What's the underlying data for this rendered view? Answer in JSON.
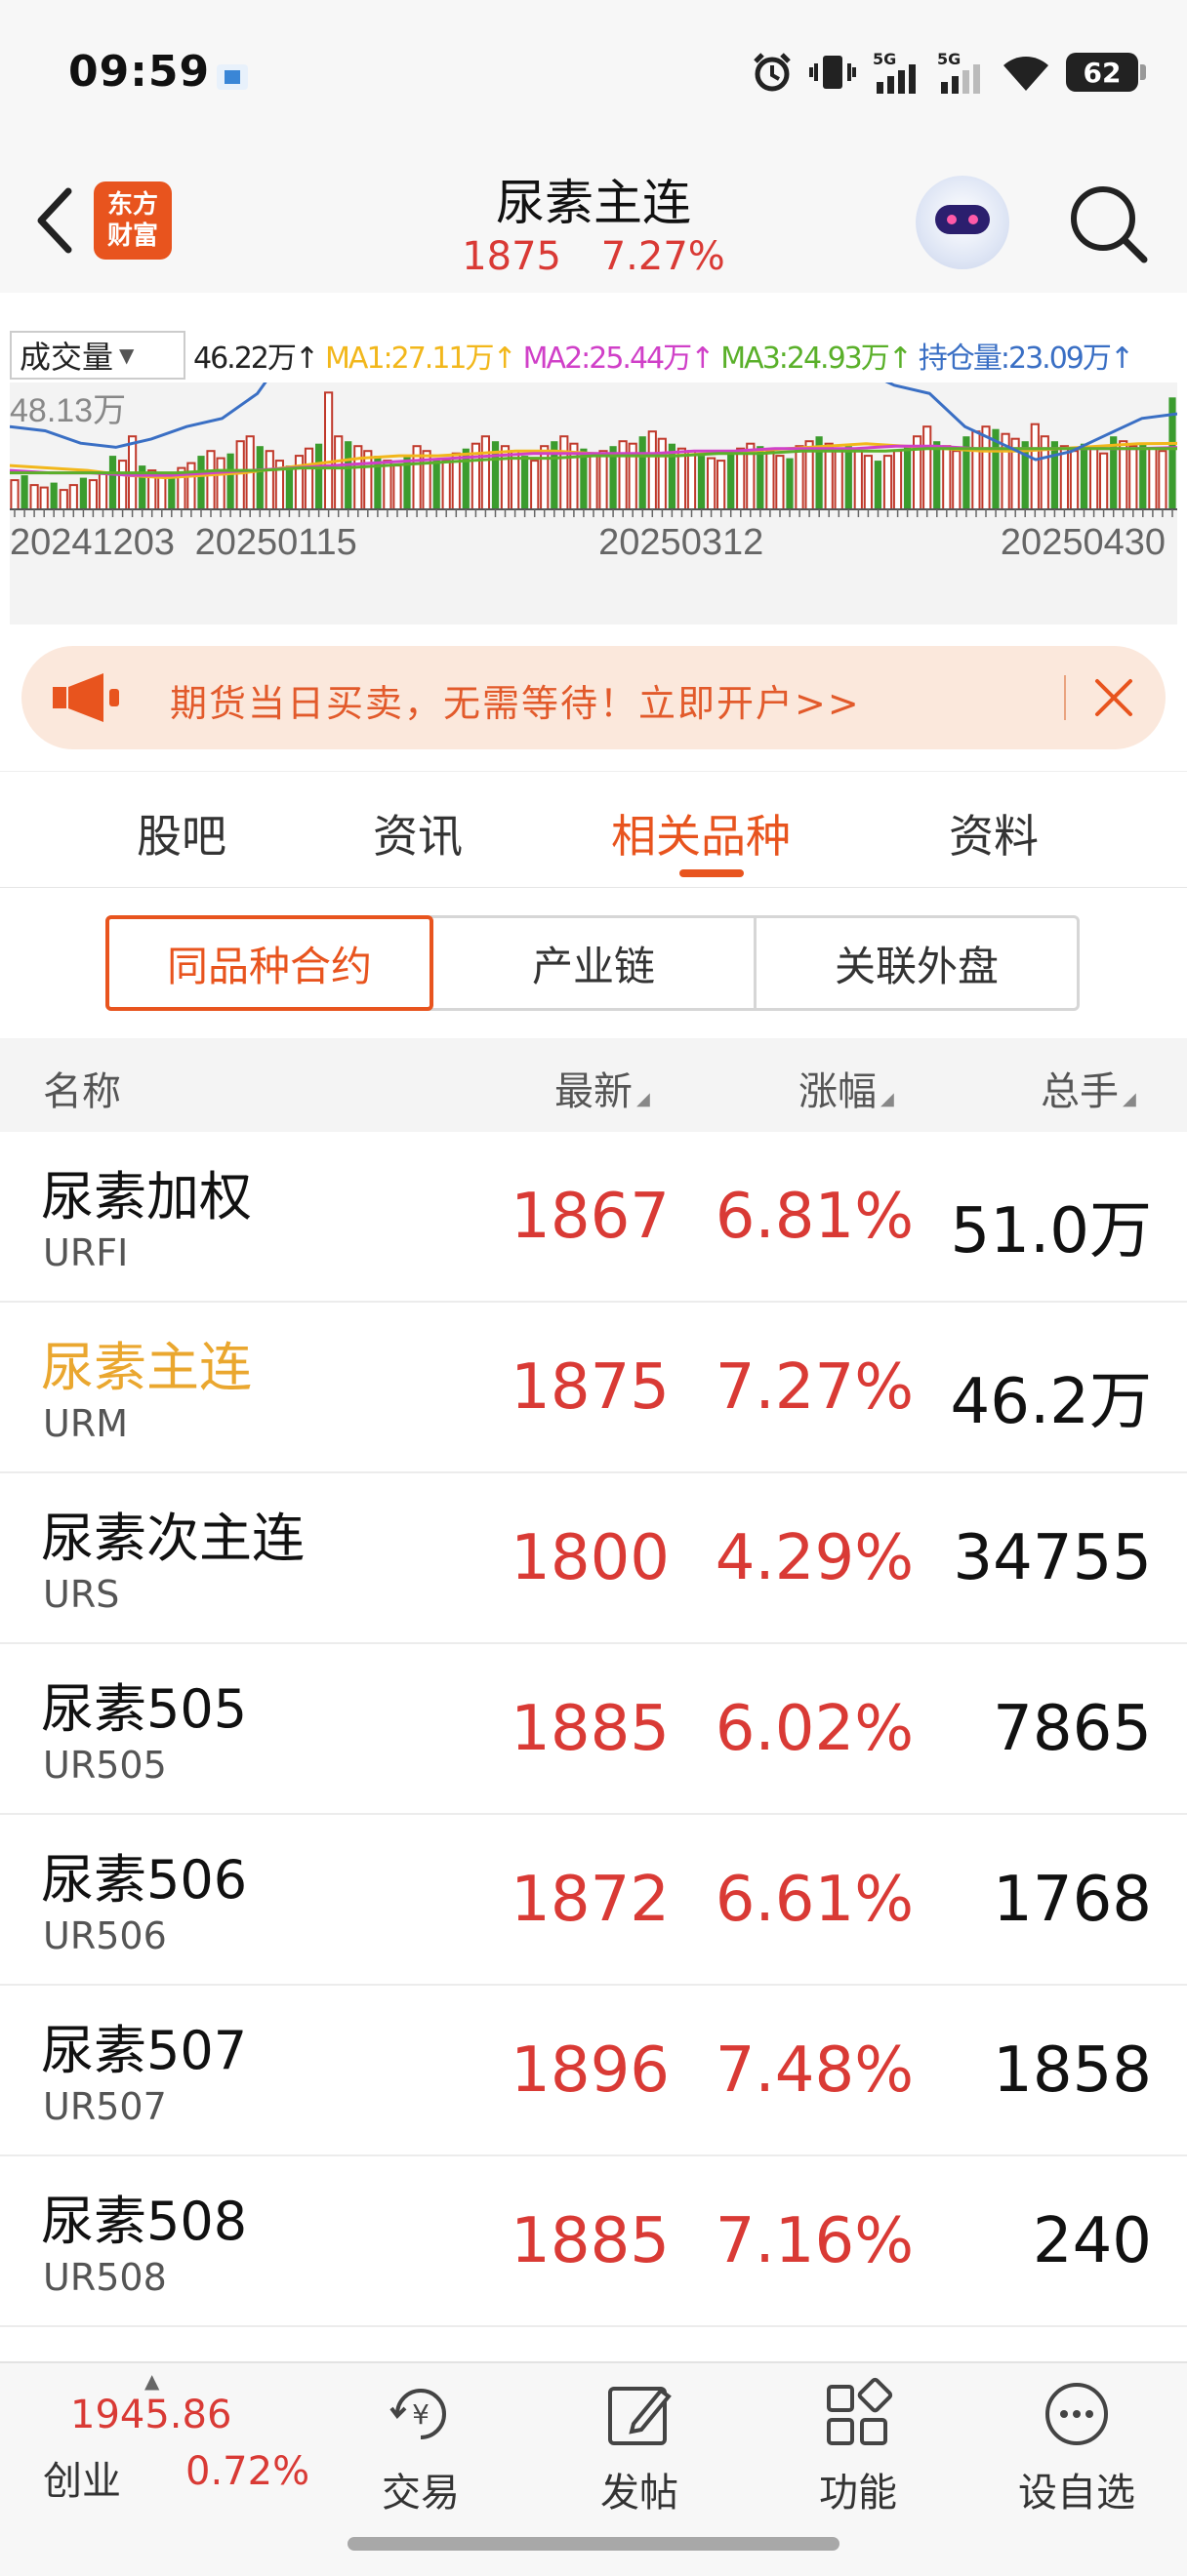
{
  "status": {
    "time": "09:59",
    "battery": "62",
    "net1": "5G",
    "net2": "5G"
  },
  "header": {
    "title": "尿素主连",
    "price": "1875",
    "change": "7.27%",
    "logo_line1": "东方",
    "logo_line2": "财富"
  },
  "chart": {
    "selector": "成交量",
    "volume_value": "46.22万↑",
    "ma1": "MA1:27.11万↑",
    "ma2": "MA2:25.44万↑",
    "ma3": "MA3:24.93万↑",
    "open_interest": "持仓量:23.09万↑",
    "max_label": "48.13万",
    "x_labels": [
      "20241203",
      "20250115",
      "20250312",
      "20250430"
    ],
    "colors": {
      "up": "#c0392b",
      "down": "#3b9c2e",
      "ma1": "#f2b71b",
      "ma2": "#d040c8",
      "ma3": "#5ab02a",
      "oi": "#3a6fc4"
    }
  },
  "chart_data": {
    "type": "bar",
    "title": "",
    "xlabel": "",
    "ylabel": "",
    "categories_range": [
      "20241203",
      "20250430"
    ],
    "ylim": [
      0,
      48.13
    ],
    "unit": "万",
    "series": [
      {
        "name": "成交量",
        "values": [
          12,
          14,
          10,
          9,
          11,
          8,
          10,
          13,
          12,
          15,
          22,
          20,
          30,
          18,
          16,
          14,
          15,
          17,
          19,
          22,
          24,
          21,
          23,
          28,
          30,
          26,
          24,
          20,
          18,
          22,
          25,
          27,
          48,
          30,
          28,
          26,
          24,
          22,
          20,
          18,
          22,
          26,
          24,
          21,
          20,
          23,
          25,
          27,
          30,
          28,
          26,
          24,
          22,
          20,
          26,
          28,
          30,
          27,
          25,
          23,
          24,
          26,
          28,
          27,
          30,
          32,
          29,
          27,
          25,
          24,
          22,
          21,
          20,
          23,
          25,
          27,
          26,
          24,
          22,
          21,
          26,
          28,
          30,
          27,
          25,
          26,
          24,
          22,
          20,
          22,
          24,
          26,
          30,
          34,
          28,
          26,
          24,
          30,
          32,
          34,
          33,
          31,
          29,
          28,
          35,
          30,
          28,
          26,
          24,
          27,
          25,
          23,
          30,
          28,
          26,
          27,
          25,
          24,
          46
        ]
      },
      {
        "name": "MA1",
        "values": [
          18,
          17,
          16,
          14,
          13,
          14,
          15,
          17,
          19,
          21,
          22,
          22,
          23,
          24,
          24,
          23,
          22,
          22,
          23,
          24,
          25,
          26,
          27,
          26,
          25,
          24,
          24,
          25,
          26,
          27,
          27.11
        ]
      },
      {
        "name": "MA2",
        "values": [
          16,
          15,
          15,
          14,
          14,
          15,
          16,
          17,
          18,
          19,
          20,
          21,
          22,
          23,
          23,
          23,
          23,
          24,
          24,
          25,
          25,
          25,
          26,
          26,
          25,
          25,
          25,
          25,
          25,
          25.44
        ]
      },
      {
        "name": "MA3",
        "values": [
          15,
          15,
          15,
          15,
          15,
          16,
          16,
          17,
          17,
          18,
          19,
          20,
          21,
          21,
          22,
          22,
          22,
          23,
          23,
          24,
          24,
          24,
          25,
          25,
          25,
          25,
          25,
          25,
          24.93
        ]
      },
      {
        "name": "持仓量",
        "values": [
          20,
          19,
          16,
          15,
          17,
          20,
          22,
          28,
          40,
          42,
          40,
          38,
          36,
          35,
          34,
          40,
          38,
          36,
          35,
          38,
          39,
          40,
          38,
          36,
          34,
          30,
          28,
          20,
          16,
          12,
          14,
          18,
          22,
          23.09
        ]
      }
    ]
  },
  "promo": {
    "text": "期货当日买卖，无需等待！立即开户>>"
  },
  "tabs": [
    {
      "label": "股吧",
      "active": false
    },
    {
      "label": "资讯",
      "active": false
    },
    {
      "label": "相关品种",
      "active": true
    },
    {
      "label": "资料",
      "active": false
    }
  ],
  "segments": [
    {
      "label": "同品种合约",
      "active": true
    },
    {
      "label": "产业链",
      "active": false
    },
    {
      "label": "关联外盘",
      "active": false
    }
  ],
  "table": {
    "headers": {
      "name": "名称",
      "latest": "最新",
      "change": "涨幅",
      "volume": "总手"
    },
    "rows": [
      {
        "name": "尿素加权",
        "code": "URFI",
        "price": "1867",
        "change": "6.81%",
        "volume": "51.0万",
        "highlight": false
      },
      {
        "name": "尿素主连",
        "code": "URM",
        "price": "1875",
        "change": "7.27%",
        "volume": "46.2万",
        "highlight": true
      },
      {
        "name": "尿素次主连",
        "code": "URS",
        "price": "1800",
        "change": "4.29%",
        "volume": "34755",
        "highlight": false
      },
      {
        "name": "尿素505",
        "code": "UR505",
        "price": "1885",
        "change": "6.02%",
        "volume": "7865",
        "highlight": false
      },
      {
        "name": "尿素506",
        "code": "UR506",
        "price": "1872",
        "change": "6.61%",
        "volume": "1768",
        "highlight": false
      },
      {
        "name": "尿素507",
        "code": "UR507",
        "price": "1896",
        "change": "7.48%",
        "volume": "1858",
        "highlight": false
      },
      {
        "name": "尿素508",
        "code": "UR508",
        "price": "1885",
        "change": "7.16%",
        "volume": "240",
        "highlight": false
      }
    ]
  },
  "bottom": {
    "index_value": "1945.86",
    "index_name": "创业",
    "index_change": "0.72%",
    "nav": [
      {
        "label": "交易",
        "icon": "yuan-refresh-icon"
      },
      {
        "label": "发帖",
        "icon": "edit-icon"
      },
      {
        "label": "功能",
        "icon": "grid-icon"
      },
      {
        "label": "设自选",
        "icon": "more-icon"
      }
    ]
  }
}
